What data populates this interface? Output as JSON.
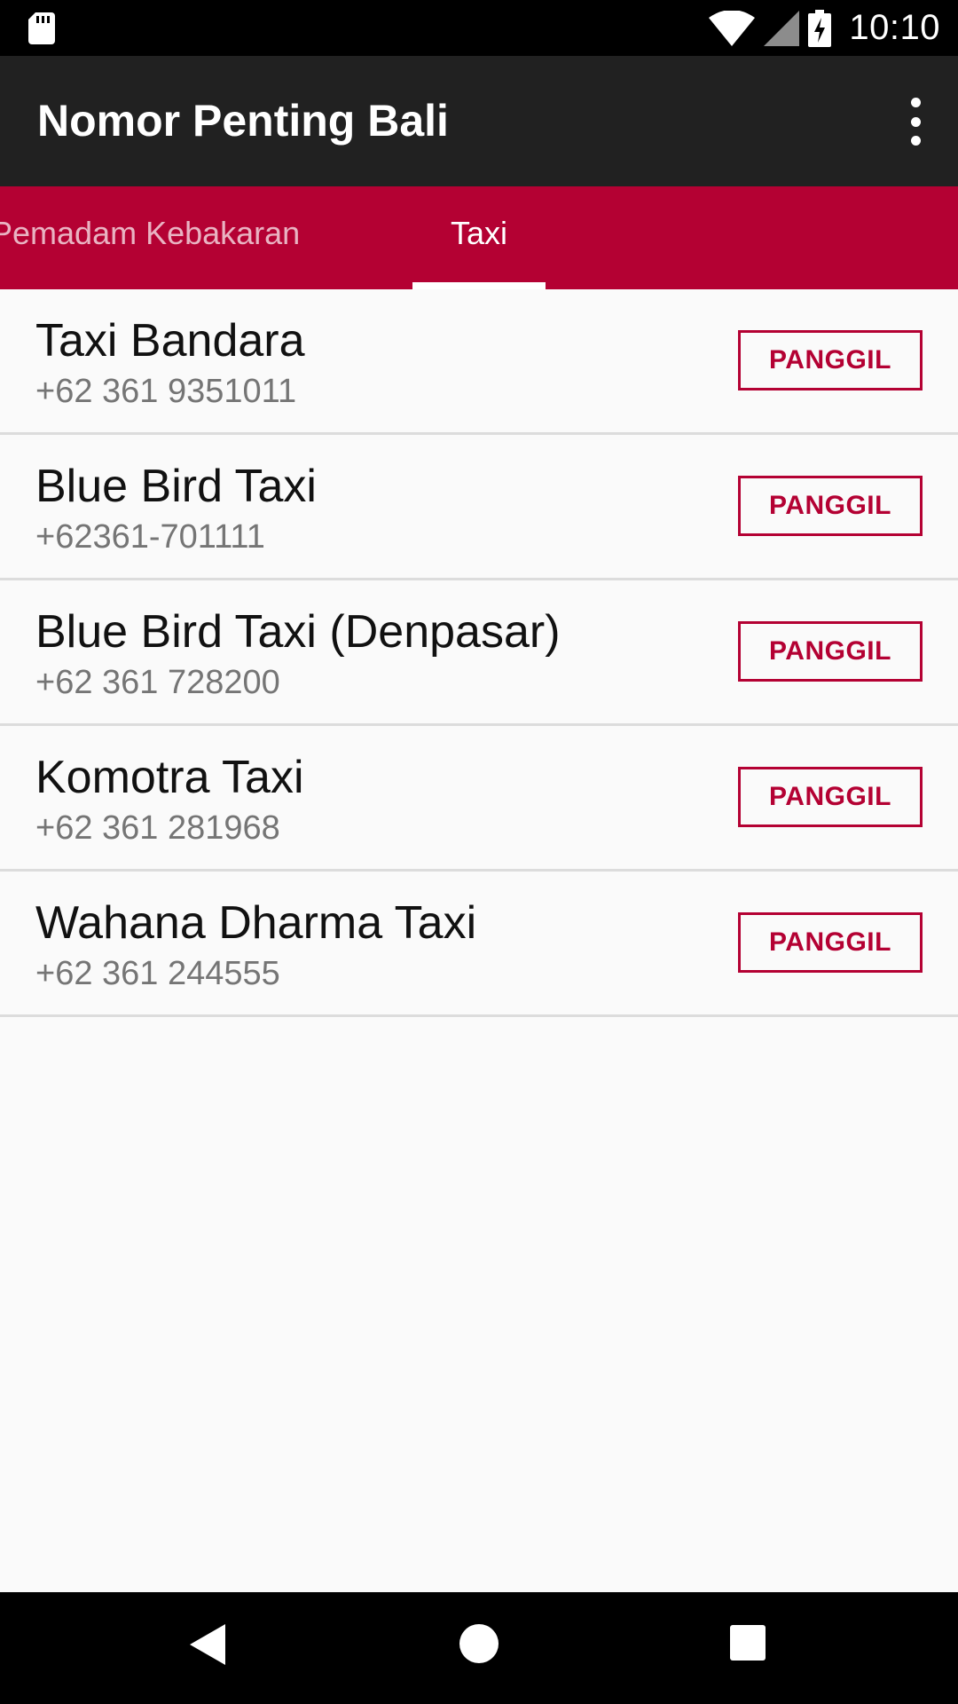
{
  "status_bar": {
    "time": "10:10",
    "icons": [
      "sd-card-icon",
      "wifi-icon",
      "cell-signal-icon",
      "battery-charging-icon"
    ]
  },
  "app_bar": {
    "title": "Nomor Penting Bali",
    "overflow_icon": "more-vert-icon"
  },
  "tabs": {
    "items": [
      {
        "label": "Pemadam Kebakaran",
        "selected": false
      },
      {
        "label": "Taxi",
        "selected": true
      }
    ]
  },
  "contacts": [
    {
      "name": "Taxi Bandara",
      "phone": "+62 361 9351011",
      "button": "PANGGIL"
    },
    {
      "name": "Blue Bird Taxi",
      "phone": "+62361-701111",
      "button": "PANGGIL"
    },
    {
      "name": "Blue Bird Taxi (Denpasar)",
      "phone": "+62 361 728200",
      "button": "PANGGIL"
    },
    {
      "name": "Komotra Taxi",
      "phone": "+62 361 281968",
      "button": "PANGGIL"
    },
    {
      "name": "Wahana Dharma Taxi",
      "phone": "+62 361 244555",
      "button": "PANGGIL"
    }
  ],
  "nav_bar": {
    "icons": [
      "back-icon",
      "home-icon",
      "recents-icon"
    ]
  },
  "colors": {
    "primary": "#212121",
    "accent": "#b40133",
    "background": "#fafafa"
  }
}
